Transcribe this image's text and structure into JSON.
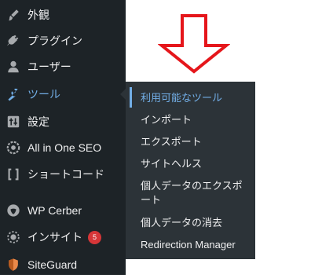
{
  "menu": [
    {
      "label": "外観",
      "icon": "paintbrush-icon"
    },
    {
      "label": "プラグイン",
      "icon": "plugin-icon"
    },
    {
      "label": "ユーザー",
      "icon": "user-icon"
    },
    {
      "label": "ツール",
      "icon": "wrench-icon",
      "active": true
    },
    {
      "label": "設定",
      "icon": "settings-sliders-icon"
    },
    {
      "label": "All in One SEO",
      "icon": "aioseo-icon"
    },
    {
      "label": "ショートコード",
      "icon": "shortcode-brackets-icon"
    },
    {
      "label": "WP Cerber",
      "icon": "cerber-icon"
    },
    {
      "label": "インサイト",
      "icon": "insights-icon",
      "badge": "5"
    },
    {
      "label": "SiteGuard",
      "icon": "siteguard-icon"
    }
  ],
  "flyout": [
    {
      "label": "利用可能なツール",
      "current": true
    },
    {
      "label": "インポート"
    },
    {
      "label": "エクスポート"
    },
    {
      "label": "サイトヘルス"
    },
    {
      "label": "個人データのエクスポート"
    },
    {
      "label": "個人データの消去"
    },
    {
      "label": "Redirection Manager"
    }
  ],
  "colors": {
    "sidebar_bg": "#1d2327",
    "flyout_bg": "#2c3338",
    "accent": "#72aee6",
    "badge": "#d63638",
    "arrow": "#e5161b"
  }
}
